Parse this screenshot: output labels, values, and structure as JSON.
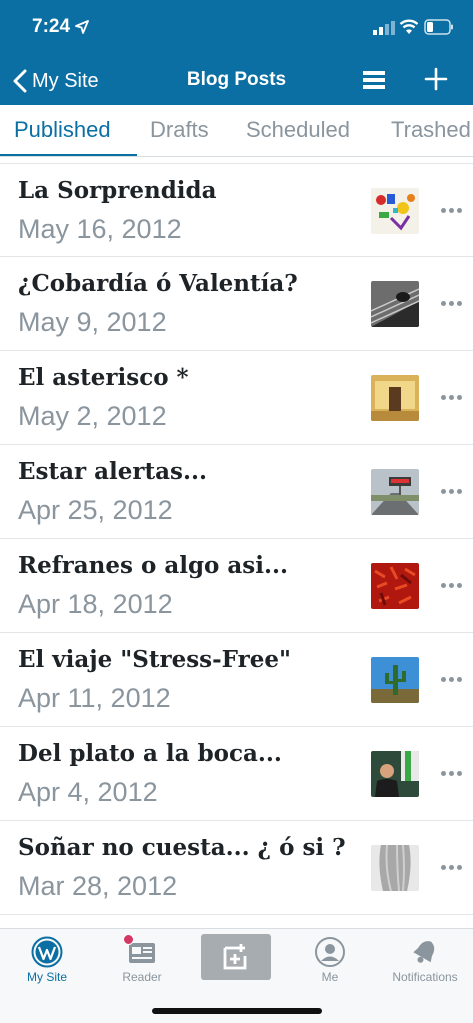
{
  "status_bar": {
    "time": "7:24"
  },
  "navbar": {
    "back_label": "My Site",
    "title": "Blog Posts"
  },
  "tabs": [
    {
      "label": "Published",
      "active": true
    },
    {
      "label": "Drafts",
      "active": false
    },
    {
      "label": "Scheduled",
      "active": false
    },
    {
      "label": "Trashed",
      "active": false
    }
  ],
  "posts": [
    {
      "title": "La Sorprendida",
      "date": "May 16, 2012",
      "thumbnail": "colorful-figures"
    },
    {
      "title": "¿Cobardía ó Valentía?",
      "date": "May 9, 2012",
      "thumbnail": "dark-stairs"
    },
    {
      "title": "El asterisco *",
      "date": "May 2, 2012",
      "thumbnail": "golden-room"
    },
    {
      "title": "Estar alertas...",
      "date": "Apr 25, 2012",
      "thumbnail": "highway-sign"
    },
    {
      "title": "Refranes o algo asi...",
      "date": "Apr 18, 2012",
      "thumbnail": "red-chilies"
    },
    {
      "title": "El viaje \"Stress-Free\"",
      "date": "Apr 11, 2012",
      "thumbnail": "desert-cactus"
    },
    {
      "title": "Del plato a la boca...",
      "date": "Apr 4, 2012",
      "thumbnail": "person-speaking"
    },
    {
      "title": "Soñar no cuesta... ¿ ó si ?",
      "date": "Mar 28, 2012",
      "thumbnail": "gray-hair"
    }
  ],
  "tabbar": {
    "my_site": "My Site",
    "reader": "Reader",
    "me": "Me",
    "notifications": "Notifications"
  },
  "colors": {
    "brand": "#0b6fa3",
    "muted": "#8a959e",
    "badge": "#d63664"
  }
}
